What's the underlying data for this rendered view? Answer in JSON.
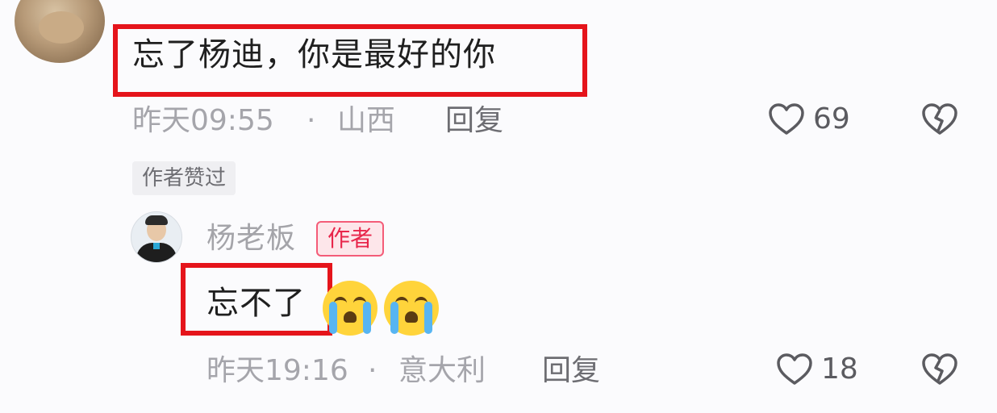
{
  "comment": {
    "text": "忘了杨迪，你是最好的你",
    "time": "昨天09:55",
    "separator": "·",
    "location": "山西",
    "reply_label": "回复",
    "likes": "69",
    "badge_liked": "作者赞过",
    "icons": [
      "avatar",
      "heart-icon",
      "broken-heart-icon"
    ]
  },
  "reply": {
    "username": "杨老板",
    "author_badge": "作者",
    "text": "忘不了",
    "emojis": [
      "crying-emoji",
      "crying-emoji"
    ],
    "time": "昨天19:16",
    "separator": "·",
    "location": "意大利",
    "reply_label": "回复",
    "likes": "18",
    "icons": [
      "avatar",
      "heart-icon",
      "broken-heart-icon"
    ]
  },
  "colors": {
    "highlight": "#e5141b",
    "author_badge": "#e8264b",
    "meta_text": "#a5a5ab"
  }
}
